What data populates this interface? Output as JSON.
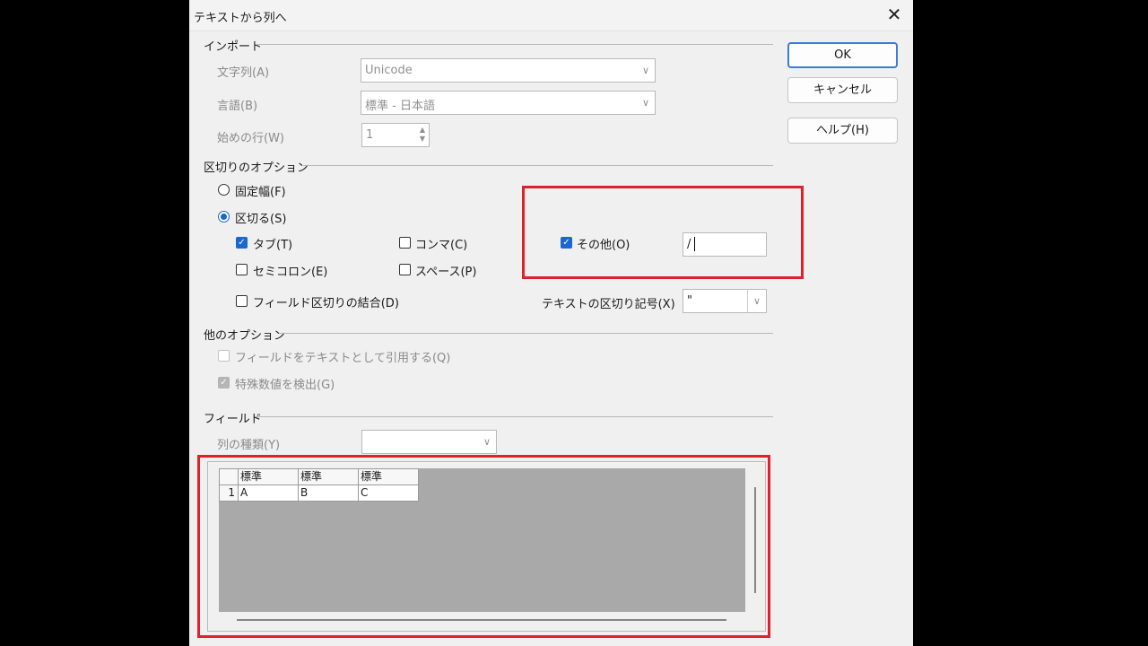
{
  "window": {
    "title": "テキストから列へ",
    "close_glyph": "✕"
  },
  "buttons": {
    "ok": "OK",
    "cancel": "キャンセル",
    "help": "ヘルプ(H)"
  },
  "import": {
    "section": "インポート",
    "charset_label": "文字列(A)",
    "charset_value": "Unicode",
    "language_label": "言語(B)",
    "language_value": "標準 - 日本語",
    "from_row_label": "始めの行(W)",
    "from_row_value": "1"
  },
  "separator": {
    "section": "区切りのオプション",
    "fixed_width": "固定幅(F)",
    "separated_by": "区切る(S)",
    "separated_by_selected": true,
    "tab": "タブ(T)",
    "tab_checked": true,
    "comma": "コンマ(C)",
    "comma_checked": false,
    "other": "その他(O)",
    "other_checked": true,
    "other_value": "/",
    "semicolon": "セミコロン(E)",
    "semicolon_checked": false,
    "space": "スペース(P)",
    "space_checked": false,
    "merge": "フィールド区切りの結合(D)",
    "merge_checked": false,
    "string_delimiter_label": "テキストの区切り記号(X)",
    "string_delimiter_value": "\""
  },
  "other_options": {
    "section": "他のオプション",
    "quoted_as_text": "フィールドをテキストとして引用する(Q)",
    "quoted_as_text_checked": false,
    "detect_special_numbers": "特殊数値を検出(G)",
    "detect_special_numbers_checked": true
  },
  "fields": {
    "section": "フィールド",
    "column_type_label": "列の種類(Y)",
    "column_type_value": "",
    "preview": {
      "headers": [
        "標準",
        "標準",
        "標準"
      ],
      "rows": [
        {
          "num": "1",
          "cells": [
            "A",
            "B",
            "C"
          ]
        }
      ]
    }
  },
  "colors": {
    "highlight": "#e0202a",
    "accent": "#1b66d1"
  }
}
